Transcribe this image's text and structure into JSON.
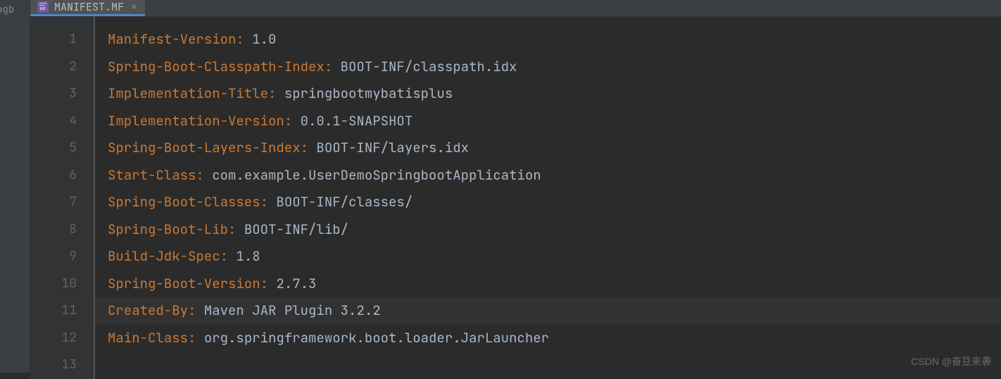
{
  "leftPanel": {
    "truncatedText": "ngb"
  },
  "tab": {
    "filename": "MANIFEST.MF",
    "iconLabel": "MF"
  },
  "gutter": {
    "lines": [
      "1",
      "2",
      "3",
      "4",
      "5",
      "6",
      "7",
      "8",
      "9",
      "10",
      "11",
      "12",
      "13"
    ]
  },
  "code": {
    "lines": [
      {
        "key": "Manifest-Version",
        "value": "1.0",
        "highlighted": false
      },
      {
        "key": "Spring-Boot-Classpath-Index",
        "value": "BOOT-INF/classpath.idx",
        "highlighted": false
      },
      {
        "key": "Implementation-Title",
        "value": "springbootmybatisplus",
        "highlighted": false
      },
      {
        "key": "Implementation-Version",
        "value": "0.0.1-SNAPSHOT",
        "highlighted": false
      },
      {
        "key": "Spring-Boot-Layers-Index",
        "value": "BOOT-INF/layers.idx",
        "highlighted": false
      },
      {
        "key": "Start-Class",
        "value": "com.example.UserDemoSpringbootApplication",
        "highlighted": false
      },
      {
        "key": "Spring-Boot-Classes",
        "value": "BOOT-INF/classes/",
        "highlighted": false
      },
      {
        "key": "Spring-Boot-Lib",
        "value": "BOOT-INF/lib/",
        "highlighted": false
      },
      {
        "key": "Build-Jdk-Spec",
        "value": "1.8",
        "highlighted": false
      },
      {
        "key": "Spring-Boot-Version",
        "value": "2.7.3",
        "highlighted": false
      },
      {
        "key": "Created-By",
        "value": "Maven JAR Plugin 3.2.2",
        "highlighted": true
      },
      {
        "key": "Main-Class",
        "value": "org.springframework.boot.loader.JarLauncher",
        "highlighted": false
      }
    ]
  },
  "watermark": "CSDN @奋豆来袭"
}
